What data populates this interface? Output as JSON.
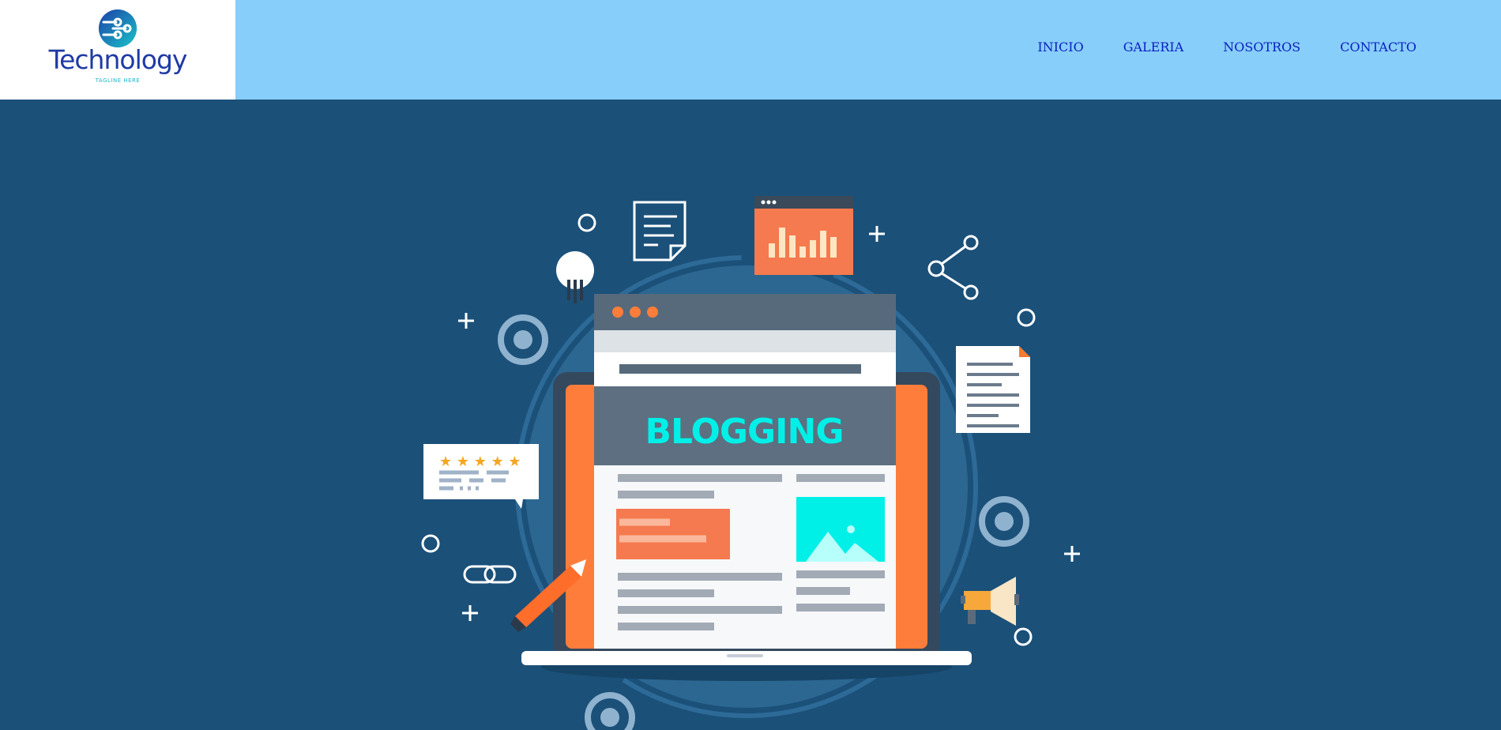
{
  "logo": {
    "name": "Technology",
    "tagline": "TAGLINE HERE"
  },
  "nav": {
    "items": [
      {
        "label": "INICIO"
      },
      {
        "label": "GALERIA"
      },
      {
        "label": "NOSOTROS"
      },
      {
        "label": "CONTACTO"
      }
    ]
  },
  "hero": {
    "screen_title": "BLOGGING",
    "icons": [
      "lightbulb-icon",
      "document-icon",
      "bar-chart-icon",
      "share-icon",
      "file-icon",
      "review-stars-icon",
      "link-icon",
      "pencil-icon",
      "megaphone-icon",
      "target-icon"
    ]
  },
  "colors": {
    "header_bg": "#87cefa",
    "hero_bg": "#1b5079",
    "nav_text": "#0a1fbf",
    "accent_orange": "#ff7b3a",
    "accent_cyan": "#00f0e8"
  }
}
